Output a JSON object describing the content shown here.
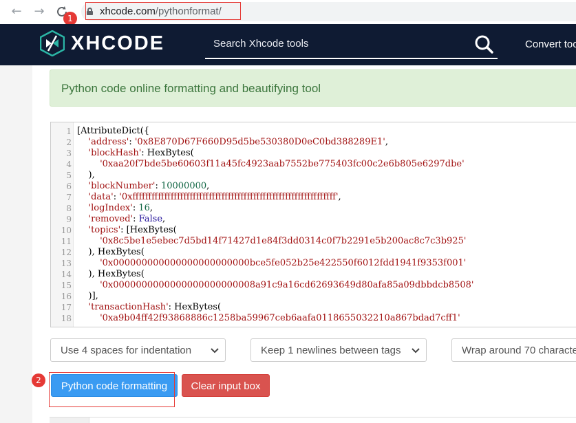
{
  "browser": {
    "url_host": "xhcode.com",
    "url_path": "/pythonformat/",
    "annotation_1": "1",
    "annotation_2": "2"
  },
  "header": {
    "logo_text": "XHCODE",
    "search_placeholder": "Search Xhcode tools",
    "convert_link": "Convert too"
  },
  "alert": {
    "text": "Python code online formatting and beautifying tool"
  },
  "editor": {
    "line_numbers": [
      "1",
      "2",
      "3",
      "4",
      "5",
      "6",
      "7",
      "8",
      "9",
      "10",
      "11",
      "12",
      "13",
      "14",
      "15",
      "16",
      "17",
      "18"
    ],
    "lines": [
      [
        [
          "p",
          "[AttributeDict({"
        ]
      ],
      [
        [
          "p",
          "    "
        ],
        [
          "s",
          "'address'"
        ],
        [
          "p",
          ": "
        ],
        [
          "s",
          "'0x8E870D67F660D95d5be530380D0eC0bd388289E1'"
        ],
        [
          "p",
          ","
        ]
      ],
      [
        [
          "p",
          "    "
        ],
        [
          "s",
          "'blockHash'"
        ],
        [
          "p",
          ": HexBytes("
        ]
      ],
      [
        [
          "p",
          "        "
        ],
        [
          "s",
          "'0xaa20f7bde5be60603f11a45fc4923aab7552be775403fc00c2e6b805e6297dbe'"
        ]
      ],
      [
        [
          "p",
          "    ),"
        ]
      ],
      [
        [
          "p",
          "    "
        ],
        [
          "s",
          "'blockNumber'"
        ],
        [
          "p",
          ": "
        ],
        [
          "n",
          "10000000"
        ],
        [
          "p",
          ","
        ]
      ],
      [
        [
          "p",
          "    "
        ],
        [
          "s",
          "'data'"
        ],
        [
          "p",
          ": "
        ],
        [
          "s",
          "'0xffffffffffffffffffffffffffffffffffffffffffffffffffffffffffffffff'"
        ],
        [
          "p",
          ","
        ]
      ],
      [
        [
          "p",
          "    "
        ],
        [
          "s",
          "'logIndex'"
        ],
        [
          "p",
          ": "
        ],
        [
          "n",
          "16"
        ],
        [
          "p",
          ","
        ]
      ],
      [
        [
          "p",
          "    "
        ],
        [
          "s",
          "'removed'"
        ],
        [
          "p",
          ": "
        ],
        [
          "k",
          "False"
        ],
        [
          "p",
          ","
        ]
      ],
      [
        [
          "p",
          "    "
        ],
        [
          "s",
          "'topics'"
        ],
        [
          "p",
          ": [HexBytes("
        ]
      ],
      [
        [
          "p",
          "        "
        ],
        [
          "s",
          "'0x8c5be1e5ebec7d5bd14f71427d1e84f3dd0314c0f7b2291e5b200ac8c7c3b925'"
        ]
      ],
      [
        [
          "p",
          "    ), HexBytes("
        ]
      ],
      [
        [
          "p",
          "        "
        ],
        [
          "s",
          "'0x000000000000000000000000bce5fe052b25e422550f6012fdd1941f9353f001'"
        ]
      ],
      [
        [
          "p",
          "    ), HexBytes("
        ]
      ],
      [
        [
          "p",
          "        "
        ],
        [
          "s",
          "'0x0000000000000000000000008a91c9a16cd62693649d80afa85a09dbbdcb8508'"
        ]
      ],
      [
        [
          "p",
          "    )],"
        ]
      ],
      [
        [
          "p",
          "    "
        ],
        [
          "s",
          "'transactionHash'"
        ],
        [
          "p",
          ": HexBytes("
        ]
      ],
      [
        [
          "p",
          "        "
        ],
        [
          "s",
          "'0xa9b04ff42f93868886c1258ba59967ceb6aafa0118655032210a867bdad7cff1'"
        ]
      ]
    ]
  },
  "options": {
    "indent": "Use 4 spaces for indentation",
    "newlines": "Keep 1 newlines between tags",
    "wrap": "Wrap around 70 characte"
  },
  "buttons": {
    "format": "Python code formatting",
    "clear": "Clear input box"
  },
  "colors": {
    "nav_background": "#0f1b33",
    "primary_button": "#3a9bf2",
    "danger_button": "#d9534f",
    "alert_background": "#dff0d8",
    "alert_text": "#3c763d",
    "annotation_red": "#e53935",
    "code_string": "#a11111",
    "code_number": "#116644",
    "code_keyword": "#221199"
  }
}
